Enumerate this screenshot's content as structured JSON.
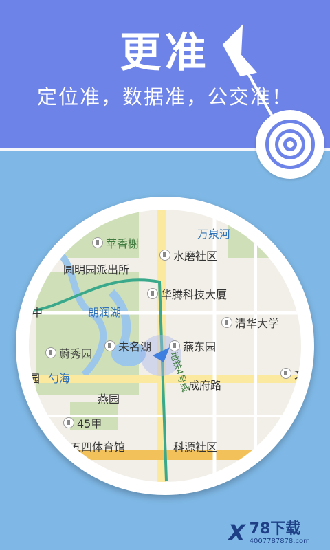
{
  "header": {
    "title": "更准",
    "subtitle": "定位准，数据准，公交准！"
  },
  "map": {
    "labels": {
      "wanquanhe": "万泉河",
      "weixiangshu": "苹香榭",
      "shuimo": "水磨社区",
      "yuanmingyuan": "圆明园派出所",
      "huateng": "华腾科技大厦",
      "langrunhu": "朗润湖",
      "zhong": "中",
      "qinghua": "清华大学",
      "weiminghu": "未名湖",
      "yandongyuan": "燕东园",
      "weixiuyuan": "蔚秀园",
      "shaohai": "勺海",
      "yuan": "园",
      "ditie": "地铁4号线",
      "chengfulu": "成府路",
      "wen": "文",
      "yanyuan": "燕园",
      "45jia": "45甲",
      "wusi": "五四体育馆",
      "keyuan": "科源社区"
    }
  },
  "watermark": {
    "brand": "78下载",
    "url": "4007787878.com"
  }
}
